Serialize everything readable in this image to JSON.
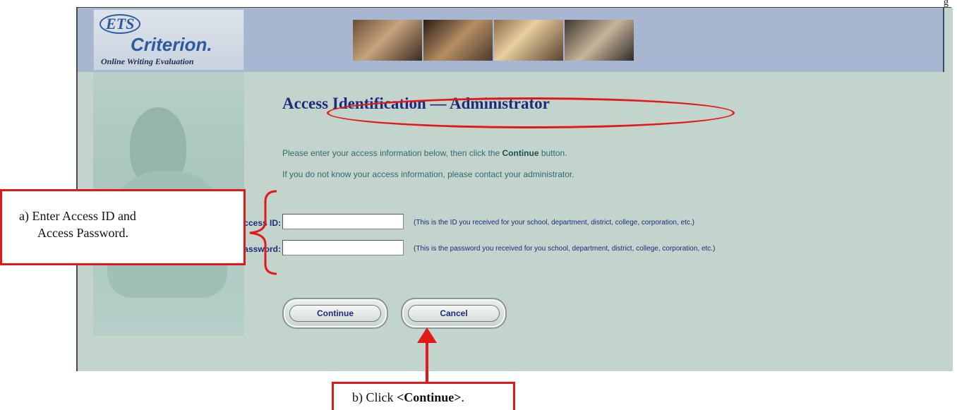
{
  "document": {
    "corner_text": "g"
  },
  "header": {
    "logo_mark": "ETS",
    "logo_name": "Criterion.",
    "logo_subtitle": "Online Writing Evaluation",
    "photo_icon": "students-at-computers-photo"
  },
  "main": {
    "title": "Access Identification — Administrator",
    "instruction_1_prefix": "Please enter your access information below, then click the ",
    "instruction_1_bold": "Continue",
    "instruction_1_suffix": " button.",
    "instruction_2": "If you do not know your access information, please contact your administrator.",
    "access_id": {
      "label": "Access ID:",
      "value": "",
      "note": "(This is the ID you received for your school, department, district, college, corporation, etc.)"
    },
    "access_password": {
      "label": "Access Password:",
      "value": "",
      "note": "(This is the password you received for you school, department, district, college, corporation, etc.)"
    },
    "buttons": {
      "continue": "Continue",
      "cancel": "Cancel"
    }
  },
  "annotations": {
    "a_line1": "a)  Enter Access ID and",
    "a_line2": "Access Password.",
    "b_prefix": "b)  Click ",
    "b_bold": "<Continue>",
    "b_suffix": ".",
    "color": "#e31919"
  },
  "colors": {
    "frame_bg": "#c3d4cd",
    "header_bg": "#a7b7d2",
    "title_text": "#1f2a7a",
    "instruction_text": "#2f6b6a",
    "annotation_red": "#e31919"
  }
}
